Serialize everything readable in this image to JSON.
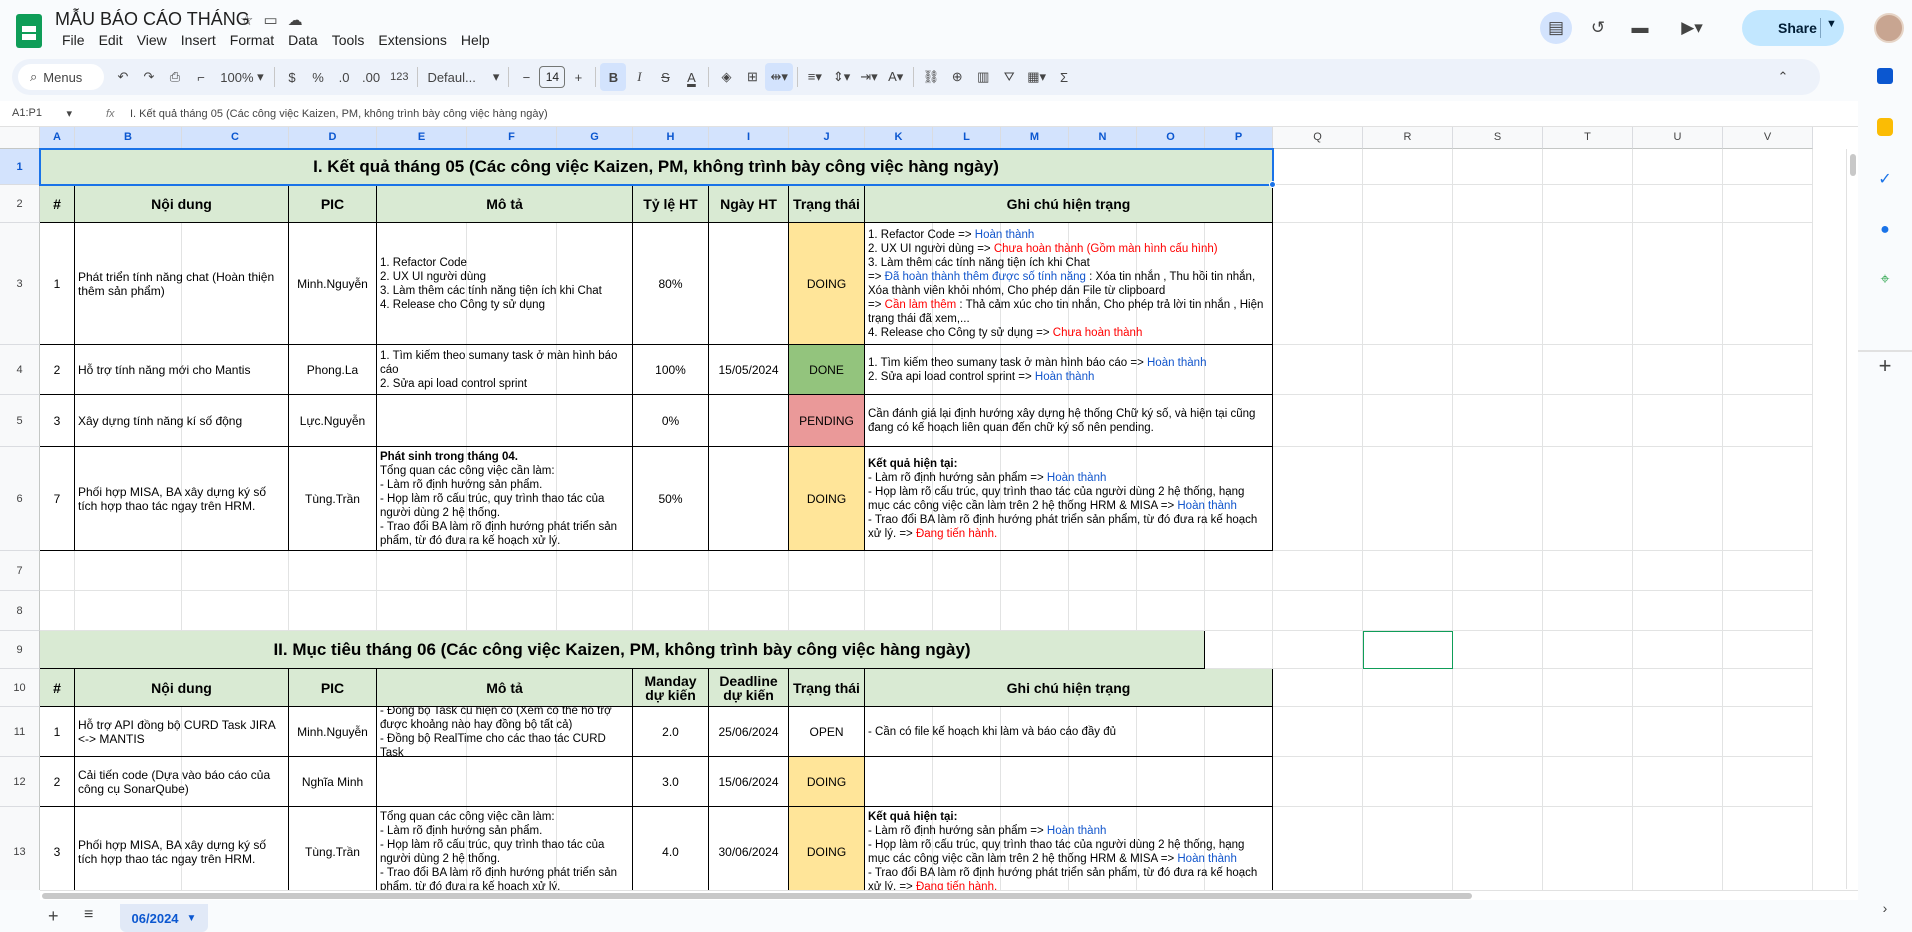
{
  "app": {
    "doc_title": "MẪU BÁO CÁO THÁNG",
    "menus": [
      "File",
      "Edit",
      "View",
      "Insert",
      "Format",
      "Data",
      "Tools",
      "Extensions",
      "Help"
    ],
    "share_label": "Share"
  },
  "toolbar": {
    "search_label": "Menus",
    "zoom": "100%",
    "currency": "$",
    "percent": "%",
    "dec_less": ".0",
    "dec_more": ".00",
    "number_format": "123",
    "font_name": "Defaul...",
    "font_size": "14",
    "minus": "−",
    "plus": "+"
  },
  "formula_bar": {
    "name_box": "A1:P1",
    "fx": "fx",
    "content": "I. Kết quả tháng 05 (Các công việc Kaizen, PM, không trình bày công việc hàng ngày)"
  },
  "columns": [
    "A",
    "B",
    "C",
    "D",
    "E",
    "F",
    "G",
    "H",
    "I",
    "J",
    "K",
    "L",
    "M",
    "N",
    "O",
    "P",
    "Q",
    "R",
    "S",
    "T",
    "U",
    "V"
  ],
  "rows": [
    "1",
    "2",
    "3",
    "4",
    "5",
    "6",
    "7",
    "8",
    "9",
    "10",
    "11",
    "12",
    "13"
  ],
  "sheet": {
    "section1_title": "I. Kết quả tháng 05 (Các công việc Kaizen, PM, không trình bày công việc hàng ngày)",
    "section2_title": "II. Mục tiêu tháng 06 (Các công việc Kaizen, PM, không trình bày công việc hàng ngày)",
    "header1": {
      "no": "#",
      "content": "Nội dung",
      "pic": "PIC",
      "desc": "Mô tả",
      "rate": "Tỷ lệ HT",
      "date": "Ngày HT",
      "status": "Trạng thái",
      "note": "Ghi chú hiện trạng"
    },
    "header2": {
      "no": "#",
      "content": "Nội dung",
      "pic": "PIC",
      "desc": "Mô tả",
      "manday_1": "Manday",
      "manday_2": "dự kiến",
      "deadline_1": "Deadline",
      "deadline_2": "dự kiến",
      "status": "Trạng thái",
      "note": "Ghi chú hiện trạng"
    },
    "r3": {
      "no": "1",
      "content": "Phát triển tính năng chat (Hoàn thiện thêm sản phẩm)",
      "pic": "Minh.Nguyễn",
      "desc": [
        "1. Refactor Code",
        "2. UX UI người dùng",
        "3. Làm thêm các tính năng tiện ích khi Chat",
        "4. Release cho Công ty sử dụng"
      ],
      "rate": "80%",
      "date": "",
      "status": "DOING",
      "n1": "1. Refactor Code => ",
      "n1b": "Hoàn thành",
      "n2": "2. UX UI người dùng => ",
      "n2r": "Chưa hoàn thành (Gồm màn hình cấu hình)",
      "n3": "3. Làm thêm các tính năng tiện ích khi Chat",
      "n4a": " => ",
      "n4b": "Đã hoàn thành thêm được số tính năng",
      "n4c": " : Xóa tin nhắn , Thu hồi tin nhắn, Xóa thành viên khỏi nhóm, Cho phép dán File từ clipboard",
      "n5a": " => ",
      "n5r": "Cần làm thêm",
      "n5c": " : Thả cảm xúc cho tin nhắn, Cho phép trả lời tin nhắn , Hiện trạng thái đã xem,...",
      "n6": "4. Release cho Công ty sử dụng => ",
      "n6r": "Chưa hoàn thành"
    },
    "r4": {
      "no": "2",
      "content": "Hỗ trợ tính năng mới cho Mantis",
      "pic": "Phong.La",
      "desc": [
        "1. Tìm kiếm theo sumany task ở màn hình báo cáo",
        "2. Sửa api load control sprint"
      ],
      "rate": "100%",
      "date": "15/05/2024",
      "status": "DONE",
      "n1": "1. Tìm kiếm theo sumany task ở màn hình báo cáo => ",
      "n1b": "Hoàn thành",
      "n2": "2. Sửa api load control sprint  => ",
      "n2b": "Hoàn thành"
    },
    "r5": {
      "no": "3",
      "content": "Xây dựng tính năng kí số động",
      "pic": "Lực.Nguyễn",
      "desc": "",
      "rate": "0%",
      "date": "",
      "status": "PENDING",
      "note": "Cần đánh giá lại định hướng xây dựng hệ thống Chữ ký số, và hiện tại cũng đang có kế hoạch liên quan đến chữ ký số nên pending."
    },
    "r6": {
      "no": "7",
      "content": "Phối hợp MISA, BA xây dựng ký số tích hợp thao tác ngay trên HRM.",
      "pic": "Tùng.Trần",
      "desc_bold": "Phát sinh trong tháng 04.",
      "desc": [
        "Tổng quan các công việc cần làm:",
        "- Làm rõ định hướng sản phẩm.",
        "- Họp làm rõ cấu trúc, quy trình thao tác của người dùng 2 hệ thống.",
        "- Trao đổi BA làm rõ định hướng phát triển sản phẩm, từ đó đưa ra kế hoạch xử lý."
      ],
      "rate": "50%",
      "date": "",
      "status": "DOING",
      "n0": "Kết quả hiện tại:",
      "n1": "- Làm rõ định hướng sản phẩm => ",
      "n1b": "Hoàn thành",
      "n2": "- Họp làm rõ cấu trúc, quy trình thao tác của người dùng 2 hệ thống, hạng mục các công việc cần làm trên 2 hệ thống HRM & MISA => ",
      "n2b": "Hoàn thành",
      "n3": "- Trao đổi BA làm rõ định hướng phát triển sản phẩm, từ đó đưa ra kế hoạch xử lý. => ",
      "n3r": "Đang tiến hành."
    },
    "r11": {
      "no": "1",
      "content": "Hỗ trợ API đồng bộ CURD Task JIRA <-> MANTIS",
      "pic": "Minh.Nguyễn",
      "desc": [
        "- Đồng bộ Task cũ hiện có (Xem có thể hỗ trợ được khoảng nào hay đồng bộ tất cả)",
        "- Đồng bộ RealTime cho các thao tác CURD Task"
      ],
      "manday": "2.0",
      "deadline": "25/06/2024",
      "status": "OPEN",
      "note": "- Cần có file kế hoạch khi làm và báo cáo đầy đủ"
    },
    "r12": {
      "no": "2",
      "content": "Cải tiến code (Dựa vào báo cáo của công cụ SonarQube)",
      "pic": "Nghĩa Minh",
      "desc": "",
      "manday": "3.0",
      "deadline": "15/06/2024",
      "status": "DOING",
      "note": ""
    },
    "r13": {
      "no": "3",
      "content": "Phối hợp MISA, BA xây dựng ký số tích hợp thao tác ngay trên HRM.",
      "pic": "Tùng.Trần",
      "desc": [
        "Tổng quan các công việc cần làm:",
        "- Làm rõ định hướng sản phẩm.",
        "- Họp làm rõ cấu trúc, quy trình thao tác của người dùng 2 hệ thống.",
        "- Trao đổi BA làm rõ định hướng phát triển sản phẩm, từ đó đưa ra kế hoạch xử lý."
      ],
      "manday": "4.0",
      "deadline": "30/06/2024",
      "status": "DOING",
      "n0": "Kết quả hiện tại:",
      "n1": "- Làm rõ định hướng sản phẩm => ",
      "n1b": "Hoàn thành",
      "n2": "- Họp làm rõ cấu trúc, quy trình thao tác của người dùng 2 hệ thống, hạng mục các công việc cần làm trên 2 hệ thống HRM & MISA => ",
      "n2b": "Hoàn thành",
      "n3": "- Trao đổi BA làm rõ định hướng phát triển sản phẩm, từ đó đưa ra kế hoạch xử lý. => ",
      "n3r": "Đang tiến hành."
    }
  },
  "sheet_tab": "06/2024",
  "colors": {
    "header_green": "#d9ead3",
    "doing": "#ffe599",
    "done": "#93c47d",
    "pending": "#ea9999",
    "selection": "#1a73e8"
  }
}
